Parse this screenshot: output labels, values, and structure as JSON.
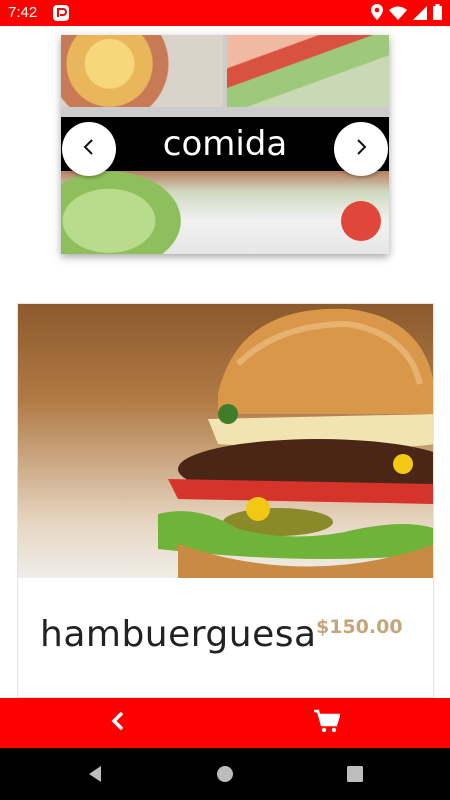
{
  "status_bar": {
    "time": "7:42",
    "icons": [
      "app-notification-icon",
      "location-icon",
      "wifi-icon",
      "signal-icon",
      "battery-icon"
    ]
  },
  "carousel": {
    "caption": "comida",
    "prev_icon": "chevron-left-icon",
    "next_icon": "chevron-right-icon"
  },
  "product": {
    "name": "hambuerguesa",
    "price": "$150.00"
  },
  "action_bar": {
    "back_icon": "back-chevron-icon",
    "cart_icon": "cart-icon"
  },
  "system_nav": {
    "icons": [
      "back-triangle-icon",
      "home-circle-icon",
      "recents-square-icon"
    ]
  },
  "colors": {
    "brand_red": "#ff0000",
    "price_gold": "#c4a57c",
    "banner_black": "#000000"
  }
}
